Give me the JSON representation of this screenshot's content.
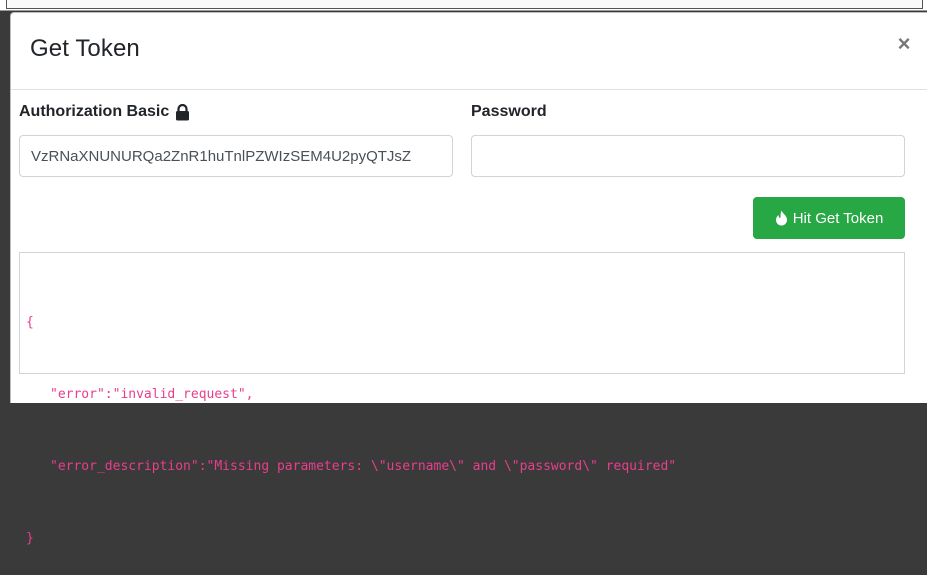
{
  "modal": {
    "title": "Get Token",
    "close_glyph": "×"
  },
  "form": {
    "auth_label": "Authorization Basic",
    "auth_icon": "lock-icon",
    "auth_value": "VzRNaXNUNURQa2ZnR1huTnlPZWIzSEM4U2pyQTJsZ",
    "password_label": "Password",
    "password_value": ""
  },
  "action": {
    "button_label": "Hit Get Token",
    "button_icon": "fire-icon",
    "button_color": "#28a745"
  },
  "response": {
    "open_brace": "{",
    "line1": "\"error\":\"invalid_request\",",
    "line2": "\"error_description\":\"Missing parameters: \\\"username\\\" and \\\"password\\\" required\"",
    "close_brace": "}",
    "text_color": "#e83e8c"
  }
}
